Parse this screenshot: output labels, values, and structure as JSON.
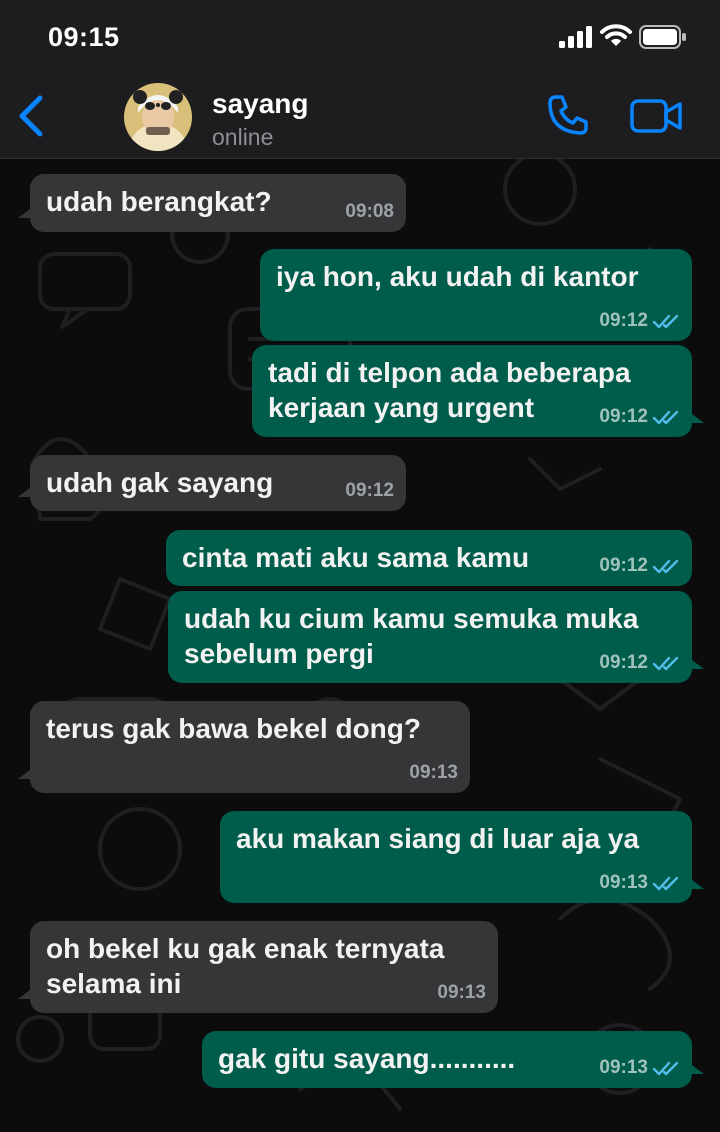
{
  "status_bar": {
    "time": "09:15"
  },
  "header": {
    "contact_name": "sayang",
    "contact_status": "online"
  },
  "colors": {
    "accent": "#0a84ff",
    "incoming_bubble": "#363638",
    "outgoing_bubble": "#005c4b",
    "read_tick": "#53bdeb"
  },
  "icons": [
    "chevron-left-icon",
    "phone-icon",
    "video-camera-icon",
    "double-check-icon"
  ],
  "messages": [
    {
      "direction": "in",
      "lines": [
        "udah berangkat?"
      ],
      "time": "09:08"
    },
    {
      "direction": "out",
      "lines": [
        "iya hon, aku udah di kantor"
      ],
      "time": "09:12",
      "read": true
    },
    {
      "direction": "out",
      "lines": [
        "tadi di telpon ada beberapa",
        "kerjaan yang urgent"
      ],
      "time": "09:12",
      "read": true
    },
    {
      "direction": "in",
      "lines": [
        "udah gak sayang"
      ],
      "time": "09:12"
    },
    {
      "direction": "out",
      "lines": [
        "cinta mati aku sama kamu"
      ],
      "time": "09:12",
      "read": true
    },
    {
      "direction": "out",
      "lines": [
        "udah ku cium kamu semuka muka",
        "sebelum pergi"
      ],
      "time": "09:12",
      "read": true
    },
    {
      "direction": "in",
      "lines": [
        "terus gak bawa bekel dong?"
      ],
      "time": "09:13"
    },
    {
      "direction": "out",
      "lines": [
        "aku makan siang di luar aja ya"
      ],
      "time": "09:13",
      "read": true
    },
    {
      "direction": "in",
      "lines": [
        "oh bekel ku gak enak ternyata",
        "selama ini"
      ],
      "time": "09:13"
    },
    {
      "direction": "out",
      "lines": [
        "gak gitu sayang..........."
      ],
      "time": "09:13",
      "read": true
    }
  ]
}
